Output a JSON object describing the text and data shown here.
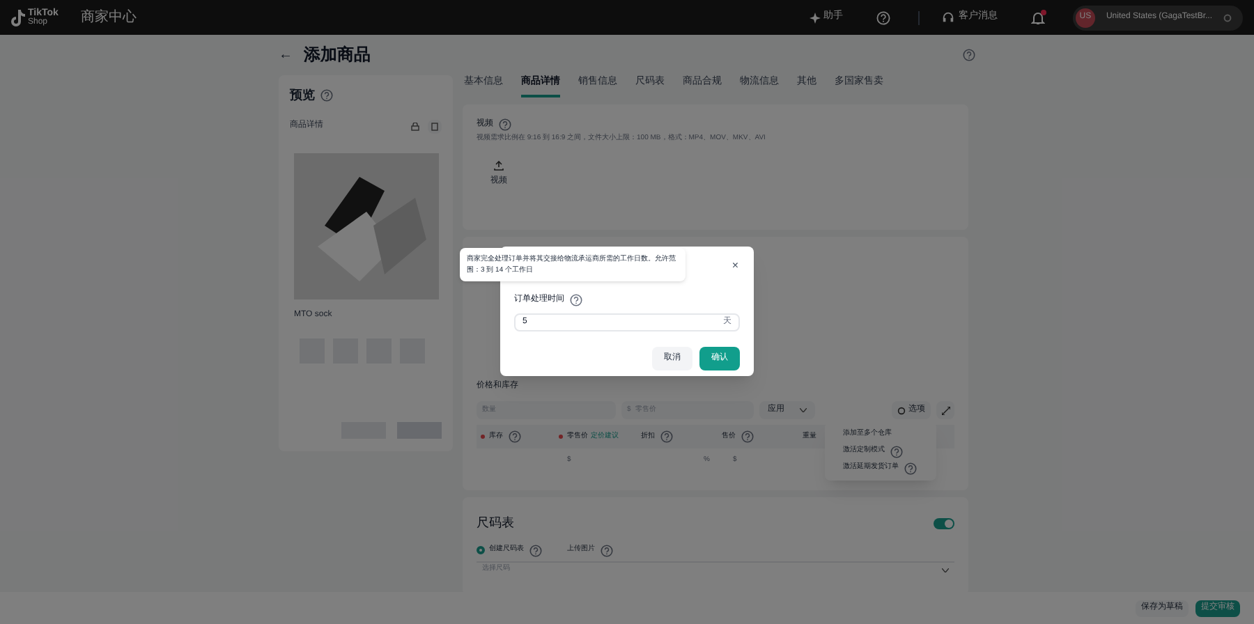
{
  "topbar": {
    "logo": "TikTok",
    "logo_sub": "Shop",
    "title": "商家中心",
    "assistant": "助手",
    "messages": "客户消息",
    "notification_dot": true,
    "avatar": "US",
    "account": "United States (GagaTestBr..."
  },
  "header": {
    "back": "←",
    "title": "添加商品"
  },
  "preview": {
    "title": "预览",
    "section": "商品详情",
    "product_name": "MTO sock"
  },
  "tabs": [
    {
      "label": "基本信息",
      "selected": false
    },
    {
      "label": "商品详情",
      "selected": true
    },
    {
      "label": "销售信息",
      "selected": false
    },
    {
      "label": "尺码表",
      "selected": false
    },
    {
      "label": "商品合规",
      "selected": false
    },
    {
      "label": "物流信息",
      "selected": false
    },
    {
      "label": "其他",
      "selected": false
    },
    {
      "label": "多国家售卖",
      "selected": false
    }
  ],
  "video": {
    "label": "视频",
    "hint": "视频需求比例在 9:16 到 16:9 之间，文件大小上限：100 MB，格式：MP4、MOV、MKV、AVI",
    "upload": "视频"
  },
  "price_stock": {
    "title": "价格和库存",
    "quantity_placeholder": "数量",
    "price_prefix": "$",
    "price_placeholder": "零售价",
    "apply": "应用",
    "options": "选项",
    "columns": [
      {
        "label": "库存",
        "required": true,
        "help": true
      },
      {
        "label": "零售价",
        "required": true,
        "help": false,
        "link": "定价建议"
      },
      {
        "label": "折扣",
        "required": false,
        "help": true
      },
      {
        "label": "售价",
        "required": false,
        "help": true
      },
      {
        "label": "重量",
        "required": false,
        "help": false
      }
    ],
    "row": [
      "$",
      "%",
      "$"
    ]
  },
  "options_menu": [
    {
      "label": "添加至多个仓库",
      "help": false
    },
    {
      "label": "激活定制模式",
      "help": true
    },
    {
      "label": "激活延期发货订单",
      "help": true
    }
  ],
  "size_chart": {
    "title": "尺码表",
    "on": true,
    "options": [
      {
        "label": "创建尺码表",
        "selected": true
      },
      {
        "label": "上传图片",
        "selected": false
      }
    ],
    "select_placeholder": "选择尺码"
  },
  "modal": {
    "tooltip": "商家完全处理订单并将其交接给物流承运商所需的工作日数。允许范围：3 到 14 个工作日",
    "close": "×",
    "field_label": "订单处理时间",
    "value": "5",
    "suffix": "天",
    "cancel": "取消",
    "confirm": "确认"
  },
  "footer": {
    "draft": "保存为草稿",
    "submit": "提交审核"
  }
}
